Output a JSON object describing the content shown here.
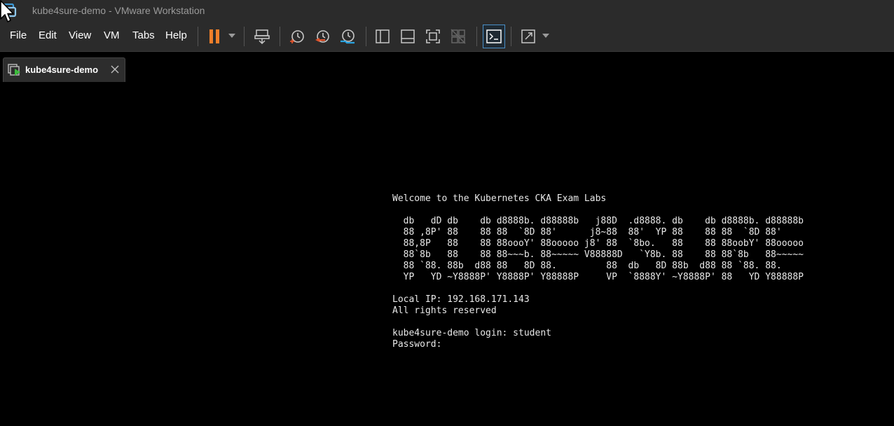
{
  "window": {
    "title": "kube4sure-demo - VMware Workstation"
  },
  "menu": [
    {
      "label": "File"
    },
    {
      "label": "Edit"
    },
    {
      "label": "View"
    },
    {
      "label": "VM"
    },
    {
      "label": "Tabs"
    },
    {
      "label": "Help"
    }
  ],
  "colors": {
    "pause_accent": "#f07f2a",
    "snapshot_revert_accent": "#e0522a",
    "snapshot_manager_accent": "#2aa3e0",
    "console_view_border": "#4a90c8"
  },
  "tab": {
    "label": "kube4sure-demo",
    "icon": "vm-running-icon"
  },
  "terminal": {
    "lines": [
      "Welcome to the Kubernetes CKA Exam Labs",
      "",
      "  db   dD db    db d8888b. d88888b   j88D  .d8888. db    db d8888b. d88888b",
      "  88 ,8P' 88    88 88  `8D 88'      j8~88  88'  YP 88    88 88  `8D 88'",
      "  88,8P   88    88 88oooY' 88ooooo j8' 88  `8bo.   88    88 88oobY' 88ooooo",
      "  88`8b   88    88 88~~~b. 88~~~~~ V88888D   `Y8b. 88    88 88`8b   88~~~~~",
      "  88 `88. 88b  d88 88   8D 88.         88  db   8D 88b  d88 88 `88. 88.",
      "  YP   YD ~Y8888P' Y8888P' Y88888P     VP  `8888Y' ~Y8888P' 88   YD Y88888P",
      "",
      "Local IP: 192.168.171.143",
      "All rights reserved",
      "",
      "kube4sure-demo login: student",
      "Password:"
    ]
  }
}
